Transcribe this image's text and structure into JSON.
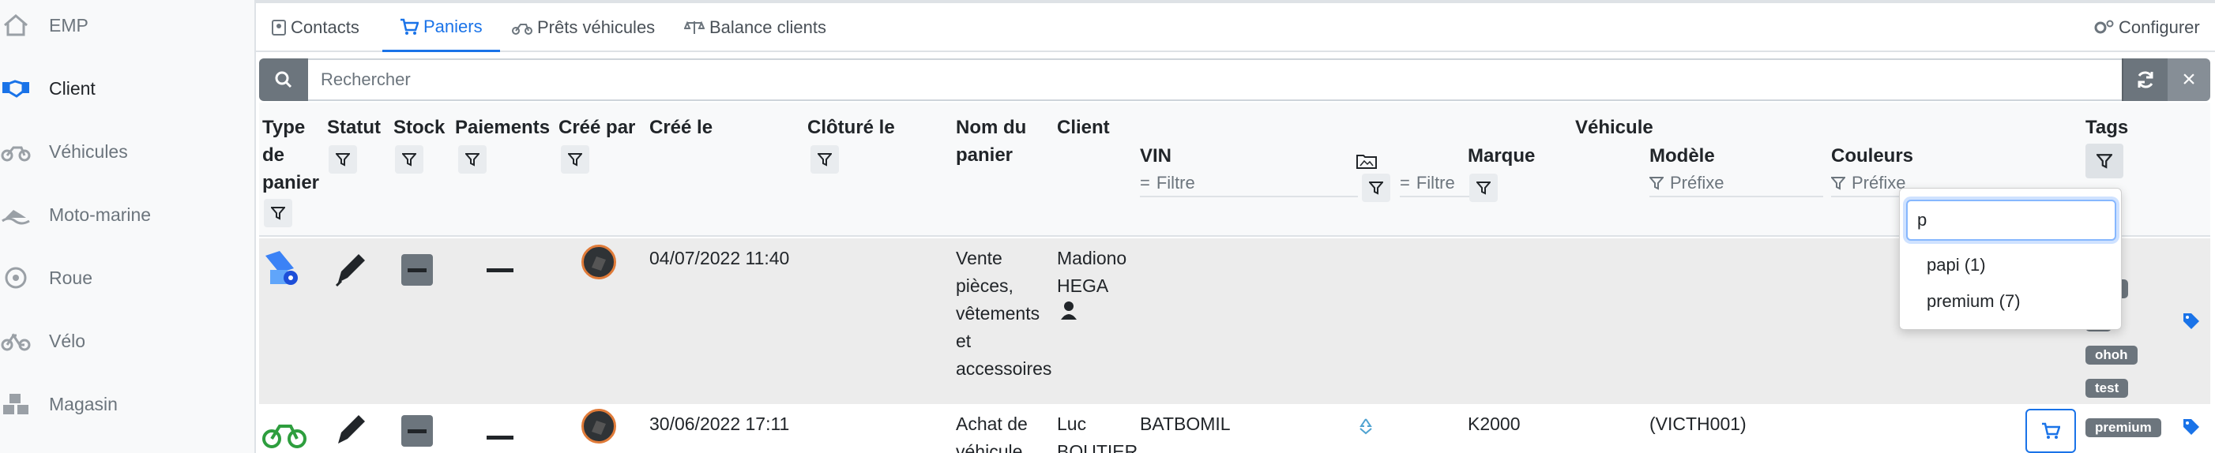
{
  "sidebar": {
    "items": [
      {
        "label": "EMP",
        "icon": "home-icon"
      },
      {
        "label": "Client",
        "icon": "handshake-icon"
      },
      {
        "label": "Véhicules",
        "icon": "motorcycle-icon"
      },
      {
        "label": "Moto-marine",
        "icon": "jetski-icon"
      },
      {
        "label": "Roue",
        "icon": "wheel-icon"
      },
      {
        "label": "Vélo",
        "icon": "bicycle-icon"
      },
      {
        "label": "Magasin",
        "icon": "boxes-icon"
      }
    ]
  },
  "tabs": [
    {
      "label": "Contacts",
      "icon": "contact-card-icon"
    },
    {
      "label": "Paniers",
      "icon": "cart-icon"
    },
    {
      "label": "Prêts véhicules",
      "icon": "motorcycle-icon"
    },
    {
      "label": "Balance clients",
      "icon": "balance-scale-icon"
    }
  ],
  "configure": {
    "label": "Configurer",
    "icon": "gears-icon"
  },
  "search": {
    "placeholder": "Rechercher"
  },
  "colors": {
    "accent": "#1a73e8",
    "badge": "#6c757d",
    "row_alt": "#ececec"
  },
  "table": {
    "headers": {
      "type_panier": [
        "Type",
        "de",
        "panier"
      ],
      "statut": "Statut",
      "stock": "Stock",
      "paiements": "Paiements",
      "cree_par": "Créé par",
      "cree_le": "Créé le",
      "cloture_le": "Clôturé le",
      "nom_panier": [
        "Nom du",
        "panier"
      ],
      "client": "Client",
      "vehicule": "Véhicule",
      "vin": "VIN",
      "marque": "Marque",
      "modele": "Modèle",
      "couleurs": "Couleurs",
      "tags": "Tags"
    },
    "filters": {
      "vin_placeholder": "Filtre",
      "marque_placeholder": "Filtre",
      "modele_placeholder": "Préfixe",
      "couleurs_placeholder": "Préfixe"
    },
    "rows": [
      {
        "created": "04/07/2022 11:40",
        "name": [
          "Vente",
          "pièces,",
          "vêtements",
          "et",
          "accessoires"
        ],
        "client": [
          "Madiono",
          "HEGA"
        ],
        "tags": [
          "a",
          "",
          "y",
          "ohoh",
          "test"
        ]
      },
      {
        "created": "30/06/2022 17:11",
        "name": [
          "Achat de",
          "véhicule"
        ],
        "client": [
          "Luc",
          "BOUTIER"
        ],
        "vin": "BATBOMIL",
        "marque": "K2000",
        "modele": "(VICTH001)",
        "tags": [
          "premium"
        ]
      }
    ]
  },
  "tag_dropdown": {
    "query": "p",
    "options": [
      "papi (1)",
      "premium (7)"
    ]
  }
}
